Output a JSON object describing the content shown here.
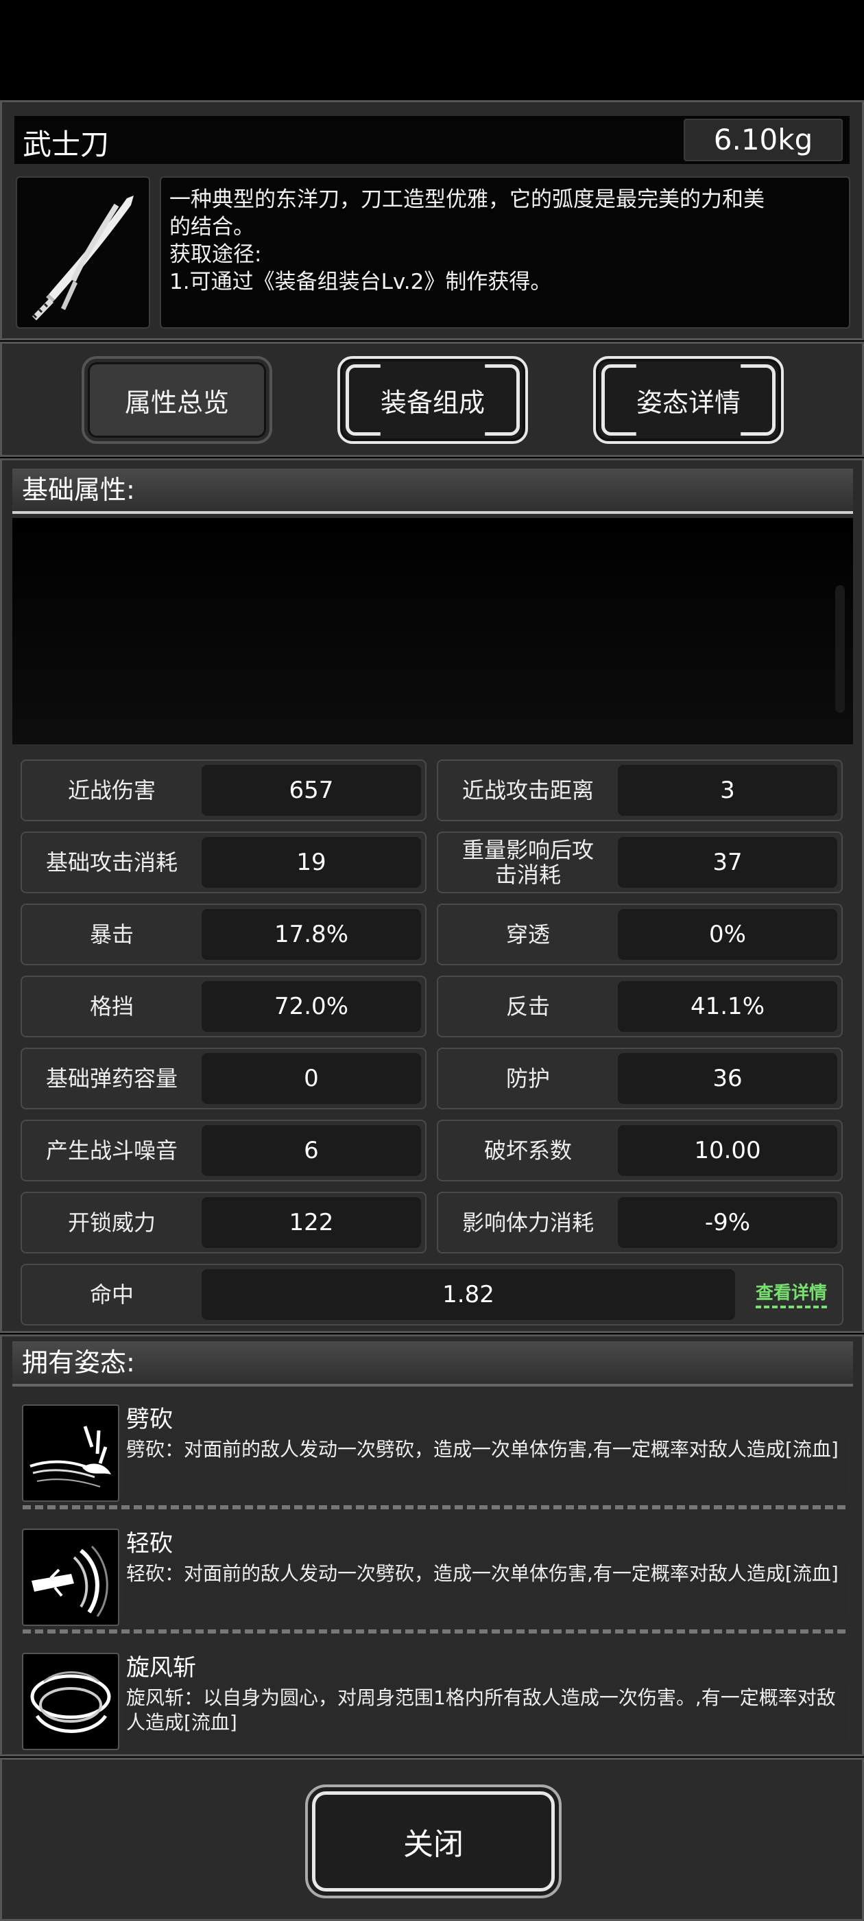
{
  "item": {
    "name": "武士刀",
    "weight": "6.10kg",
    "description": [
      "一种典型的东洋刀，刀工造型优雅，它的弧度是最完美的力和美",
      "的结合。",
      "获取途径:",
      "1.可通过《装备组装台Lv.2》制作获得。"
    ],
    "icon": "katana-icon"
  },
  "tabs": [
    "属性总览",
    "装备组成",
    "姿态详情"
  ],
  "attributes": {
    "header": "基础属性:",
    "stats": [
      {
        "label": "近战伤害",
        "value": "657"
      },
      {
        "label": "近战攻击距离",
        "value": "3"
      },
      {
        "label": "基础攻击消耗",
        "value": "19"
      },
      {
        "label": "重量影响后攻击消耗",
        "value": "37"
      },
      {
        "label": "暴击",
        "value": "17.8%"
      },
      {
        "label": "穿透",
        "value": "0%"
      },
      {
        "label": "格挡",
        "value": "72.0%"
      },
      {
        "label": "反击",
        "value": "41.1%"
      },
      {
        "label": "基础弹药容量",
        "value": "0"
      },
      {
        "label": "防护",
        "value": "36"
      },
      {
        "label": "产生战斗噪音",
        "value": "6"
      },
      {
        "label": "破坏系数",
        "value": "10.00"
      },
      {
        "label": "开锁威力",
        "value": "122"
      },
      {
        "label": "影响体力消耗",
        "value": "-9%"
      }
    ],
    "hit": {
      "label": "命中",
      "value": "1.82",
      "detail": "查看详情"
    }
  },
  "stances": {
    "header": "拥有姿态:",
    "items": [
      {
        "name": "劈砍",
        "desc": "劈砍：对面前的敌人发动一次劈砍，造成一次单体伤害,有一定概率对敌人造成[流血]",
        "icon": "slash-icon"
      },
      {
        "name": "轻砍",
        "desc": "轻砍：对面前的敌人发动一次劈砍，造成一次单体伤害,有一定概率对敌人造成[流血]",
        "icon": "light-slash-icon"
      },
      {
        "name": "旋风斩",
        "desc": "旋风斩：以自身为圆心，对周身范围1格内所有敌人造成一次伤害。,有一定概率对敌人造成[流血]",
        "icon": "whirlwind-icon"
      }
    ]
  },
  "footer": {
    "close": "关闭"
  }
}
